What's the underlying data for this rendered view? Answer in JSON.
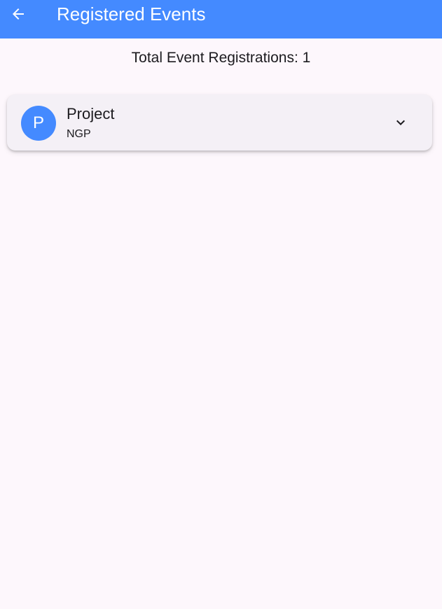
{
  "app_bar": {
    "title": "Registered Events",
    "back_icon": "arrow-back-icon",
    "background_color": "#448aff",
    "text_color": "#ffffff"
  },
  "summary": {
    "text": "Total Event Registrations: 1"
  },
  "events": [
    {
      "avatar_letter": "P",
      "title": "Project",
      "subtitle": "NGP",
      "expand_icon": "chevron-down-icon",
      "avatar_color": "#448aff"
    }
  ],
  "colors": {
    "page_background": "#fdf7fc",
    "card_background": "#f4f0f6",
    "text_primary": "#1c1b1f"
  }
}
